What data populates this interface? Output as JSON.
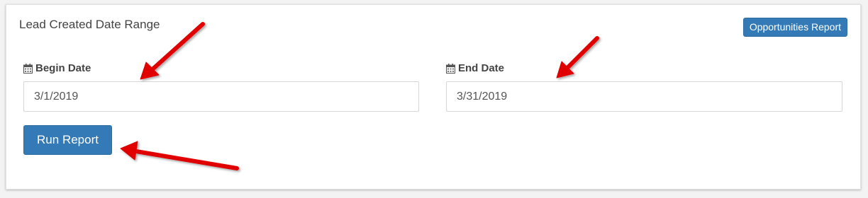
{
  "panel": {
    "title": "Lead Created Date Range",
    "report_button_label": "Opportunities Report"
  },
  "begin_date": {
    "label": "Begin Date",
    "value": "3/1/2019",
    "icon": "calendar-icon"
  },
  "end_date": {
    "label": "End Date",
    "value": "3/31/2019",
    "icon": "calendar-icon"
  },
  "run_button_label": "Run Report",
  "colors": {
    "primary": "#337ab7",
    "annotation_arrow": "#e00000"
  },
  "annotations": {
    "icon": "red-arrow-icon",
    "count": 3
  }
}
